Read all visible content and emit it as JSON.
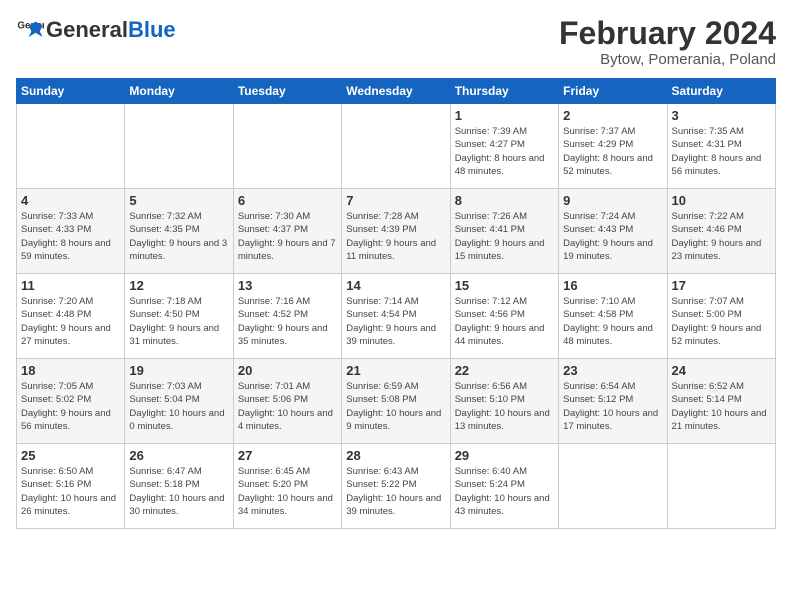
{
  "logo": {
    "text_general": "General",
    "text_blue": "Blue"
  },
  "title": "February 2024",
  "subtitle": "Bytow, Pomerania, Poland",
  "days_of_week": [
    "Sunday",
    "Monday",
    "Tuesday",
    "Wednesday",
    "Thursday",
    "Friday",
    "Saturday"
  ],
  "weeks": [
    [
      null,
      null,
      null,
      null,
      {
        "day": "1",
        "sunrise": "Sunrise: 7:39 AM",
        "sunset": "Sunset: 4:27 PM",
        "daylight": "Daylight: 8 hours and 48 minutes."
      },
      {
        "day": "2",
        "sunrise": "Sunrise: 7:37 AM",
        "sunset": "Sunset: 4:29 PM",
        "daylight": "Daylight: 8 hours and 52 minutes."
      },
      {
        "day": "3",
        "sunrise": "Sunrise: 7:35 AM",
        "sunset": "Sunset: 4:31 PM",
        "daylight": "Daylight: 8 hours and 56 minutes."
      }
    ],
    [
      {
        "day": "4",
        "sunrise": "Sunrise: 7:33 AM",
        "sunset": "Sunset: 4:33 PM",
        "daylight": "Daylight: 8 hours and 59 minutes."
      },
      {
        "day": "5",
        "sunrise": "Sunrise: 7:32 AM",
        "sunset": "Sunset: 4:35 PM",
        "daylight": "Daylight: 9 hours and 3 minutes."
      },
      {
        "day": "6",
        "sunrise": "Sunrise: 7:30 AM",
        "sunset": "Sunset: 4:37 PM",
        "daylight": "Daylight: 9 hours and 7 minutes."
      },
      {
        "day": "7",
        "sunrise": "Sunrise: 7:28 AM",
        "sunset": "Sunset: 4:39 PM",
        "daylight": "Daylight: 9 hours and 11 minutes."
      },
      {
        "day": "8",
        "sunrise": "Sunrise: 7:26 AM",
        "sunset": "Sunset: 4:41 PM",
        "daylight": "Daylight: 9 hours and 15 minutes."
      },
      {
        "day": "9",
        "sunrise": "Sunrise: 7:24 AM",
        "sunset": "Sunset: 4:43 PM",
        "daylight": "Daylight: 9 hours and 19 minutes."
      },
      {
        "day": "10",
        "sunrise": "Sunrise: 7:22 AM",
        "sunset": "Sunset: 4:46 PM",
        "daylight": "Daylight: 9 hours and 23 minutes."
      }
    ],
    [
      {
        "day": "11",
        "sunrise": "Sunrise: 7:20 AM",
        "sunset": "Sunset: 4:48 PM",
        "daylight": "Daylight: 9 hours and 27 minutes."
      },
      {
        "day": "12",
        "sunrise": "Sunrise: 7:18 AM",
        "sunset": "Sunset: 4:50 PM",
        "daylight": "Daylight: 9 hours and 31 minutes."
      },
      {
        "day": "13",
        "sunrise": "Sunrise: 7:16 AM",
        "sunset": "Sunset: 4:52 PM",
        "daylight": "Daylight: 9 hours and 35 minutes."
      },
      {
        "day": "14",
        "sunrise": "Sunrise: 7:14 AM",
        "sunset": "Sunset: 4:54 PM",
        "daylight": "Daylight: 9 hours and 39 minutes."
      },
      {
        "day": "15",
        "sunrise": "Sunrise: 7:12 AM",
        "sunset": "Sunset: 4:56 PM",
        "daylight": "Daylight: 9 hours and 44 minutes."
      },
      {
        "day": "16",
        "sunrise": "Sunrise: 7:10 AM",
        "sunset": "Sunset: 4:58 PM",
        "daylight": "Daylight: 9 hours and 48 minutes."
      },
      {
        "day": "17",
        "sunrise": "Sunrise: 7:07 AM",
        "sunset": "Sunset: 5:00 PM",
        "daylight": "Daylight: 9 hours and 52 minutes."
      }
    ],
    [
      {
        "day": "18",
        "sunrise": "Sunrise: 7:05 AM",
        "sunset": "Sunset: 5:02 PM",
        "daylight": "Daylight: 9 hours and 56 minutes."
      },
      {
        "day": "19",
        "sunrise": "Sunrise: 7:03 AM",
        "sunset": "Sunset: 5:04 PM",
        "daylight": "Daylight: 10 hours and 0 minutes."
      },
      {
        "day": "20",
        "sunrise": "Sunrise: 7:01 AM",
        "sunset": "Sunset: 5:06 PM",
        "daylight": "Daylight: 10 hours and 4 minutes."
      },
      {
        "day": "21",
        "sunrise": "Sunrise: 6:59 AM",
        "sunset": "Sunset: 5:08 PM",
        "daylight": "Daylight: 10 hours and 9 minutes."
      },
      {
        "day": "22",
        "sunrise": "Sunrise: 6:56 AM",
        "sunset": "Sunset: 5:10 PM",
        "daylight": "Daylight: 10 hours and 13 minutes."
      },
      {
        "day": "23",
        "sunrise": "Sunrise: 6:54 AM",
        "sunset": "Sunset: 5:12 PM",
        "daylight": "Daylight: 10 hours and 17 minutes."
      },
      {
        "day": "24",
        "sunrise": "Sunrise: 6:52 AM",
        "sunset": "Sunset: 5:14 PM",
        "daylight": "Daylight: 10 hours and 21 minutes."
      }
    ],
    [
      {
        "day": "25",
        "sunrise": "Sunrise: 6:50 AM",
        "sunset": "Sunset: 5:16 PM",
        "daylight": "Daylight: 10 hours and 26 minutes."
      },
      {
        "day": "26",
        "sunrise": "Sunrise: 6:47 AM",
        "sunset": "Sunset: 5:18 PM",
        "daylight": "Daylight: 10 hours and 30 minutes."
      },
      {
        "day": "27",
        "sunrise": "Sunrise: 6:45 AM",
        "sunset": "Sunset: 5:20 PM",
        "daylight": "Daylight: 10 hours and 34 minutes."
      },
      {
        "day": "28",
        "sunrise": "Sunrise: 6:43 AM",
        "sunset": "Sunset: 5:22 PM",
        "daylight": "Daylight: 10 hours and 39 minutes."
      },
      {
        "day": "29",
        "sunrise": "Sunrise: 6:40 AM",
        "sunset": "Sunset: 5:24 PM",
        "daylight": "Daylight: 10 hours and 43 minutes."
      },
      null,
      null
    ]
  ]
}
